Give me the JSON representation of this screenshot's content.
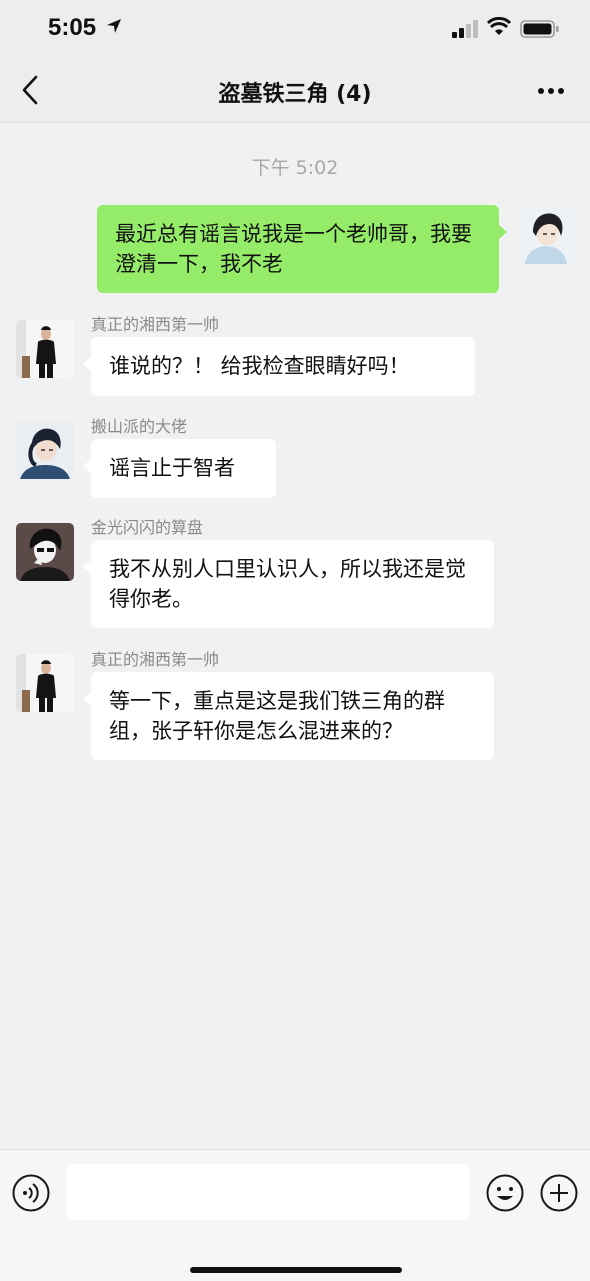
{
  "status_bar": {
    "time": "5:05"
  },
  "header": {
    "title": "盗墓铁三角 (4)"
  },
  "chat": {
    "timestamp": "下午 5:02",
    "messages": [
      {
        "direction": "out",
        "text": "最近总有谣言说我是一个老帅哥，我要澄清一下，我不老"
      },
      {
        "direction": "in",
        "sender": "真正的湘西第一帅",
        "text": "谁说的？！ 给我检查眼睛好吗！"
      },
      {
        "direction": "in",
        "sender": "搬山派的大佬",
        "text": "谣言止于智者"
      },
      {
        "direction": "in",
        "sender": "金光闪闪的算盘",
        "text": "我不从别人口里认识人，所以我还是觉得你老。"
      },
      {
        "direction": "in",
        "sender": "真正的湘西第一帅",
        "text": "等一下，重点是这是我们铁三角的群组，张子轩你是怎么混进来的？"
      }
    ]
  },
  "input_bar": {
    "value": ""
  },
  "colors": {
    "outgoing_bubble": "#95EC69",
    "incoming_bubble": "#FFFFFF",
    "chat_background": "#F1F1F1"
  }
}
